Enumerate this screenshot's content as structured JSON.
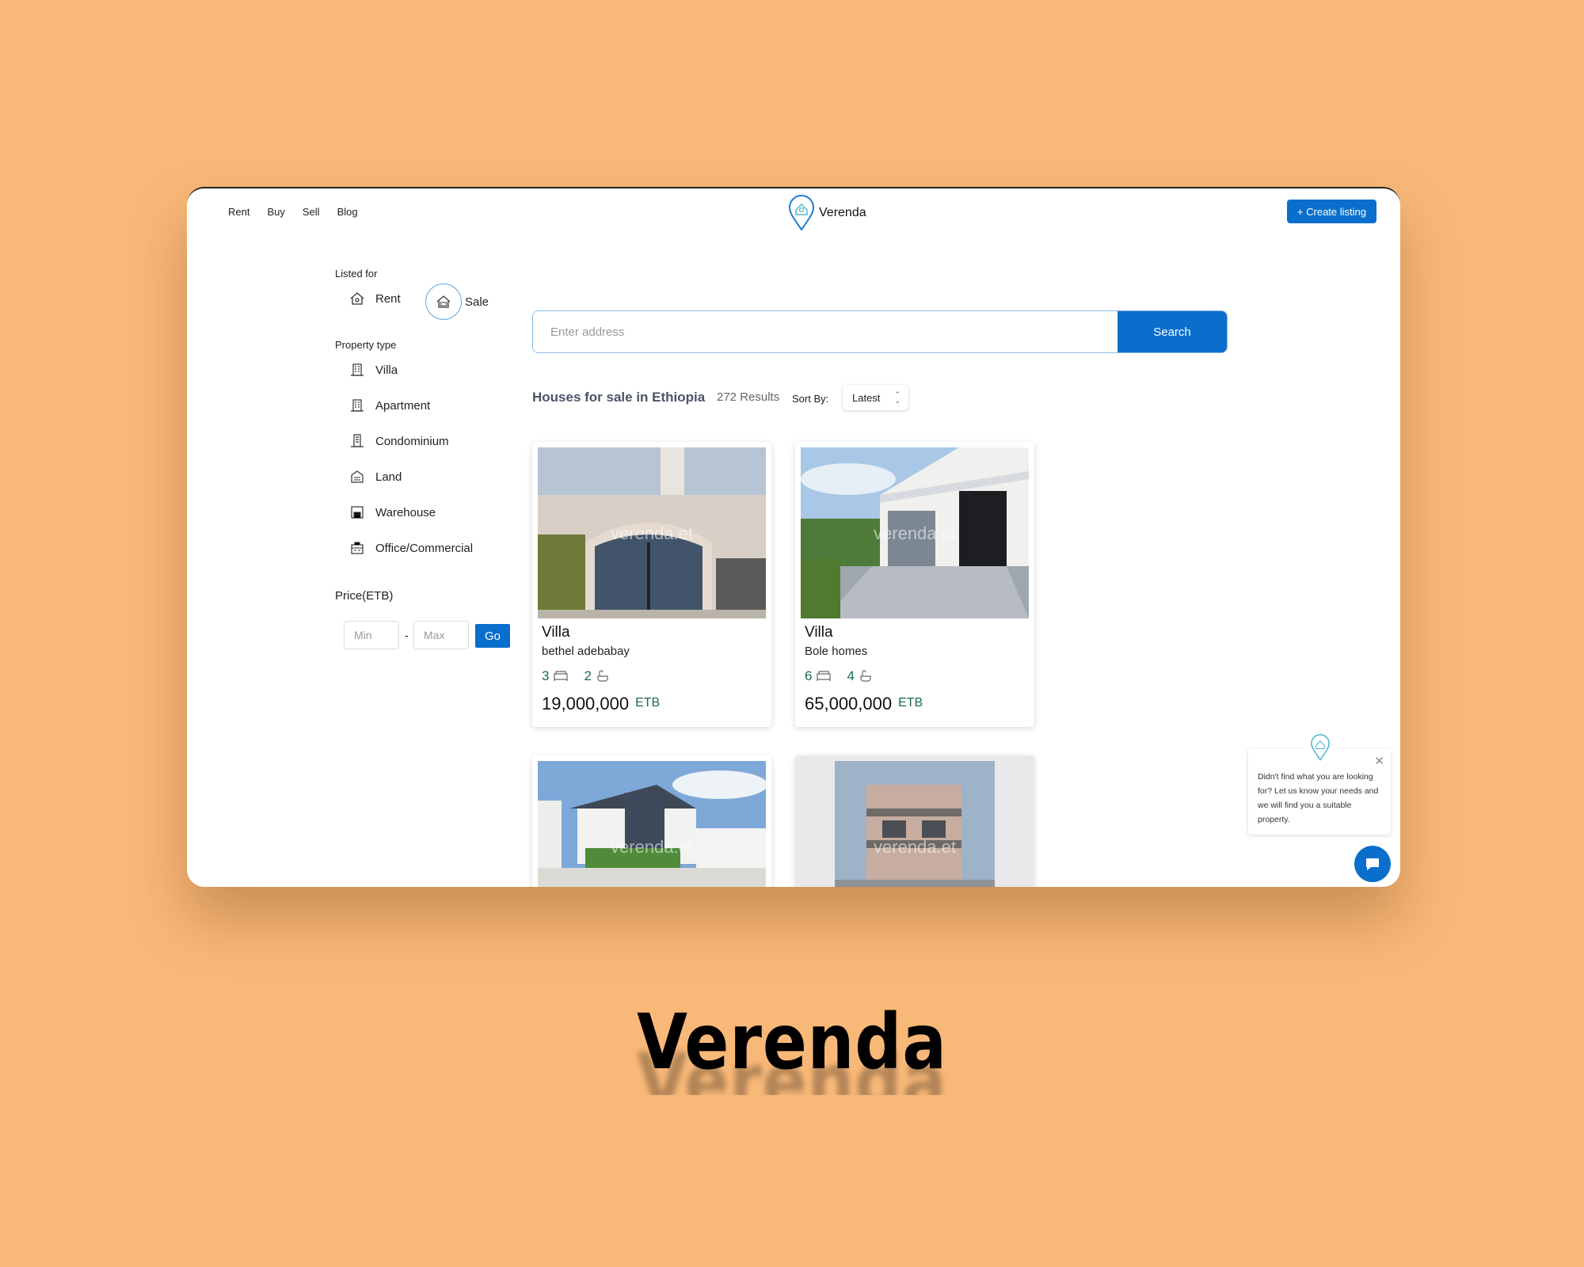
{
  "nav": {
    "links": [
      "Rent",
      "Buy",
      "Sell",
      "Blog"
    ],
    "brand": "Verenda",
    "create_listing": "+ Create listing"
  },
  "sidebar": {
    "listed_for_label": "Listed for",
    "listed_for": [
      {
        "label": "Rent",
        "icon": "house-key-icon"
      },
      {
        "label": "Sale",
        "icon": "house-sale-icon",
        "selected": true
      }
    ],
    "property_type_label": "Property type",
    "property_types": [
      {
        "label": "Villa",
        "icon": "villa-icon"
      },
      {
        "label": "Apartment",
        "icon": "apartment-icon"
      },
      {
        "label": "Condominium",
        "icon": "condominium-icon"
      },
      {
        "label": "Land",
        "icon": "land-icon"
      },
      {
        "label": "Warehouse",
        "icon": "warehouse-icon"
      },
      {
        "label": "Office/Commercial",
        "icon": "office-icon"
      }
    ],
    "price_label": "Price(ETB)",
    "min_placeholder": "Min",
    "max_placeholder": "Max",
    "separator": "-",
    "go_label": "Go"
  },
  "search": {
    "placeholder": "Enter address",
    "button": "Search"
  },
  "results": {
    "title": "Houses for sale in Ethiopia",
    "count": "272 Results",
    "sort_label": "Sort By:",
    "sort_value": "Latest"
  },
  "watermark": "verenda.et",
  "listings": [
    {
      "type": "Villa",
      "owner": "bethel adebabay",
      "beds": "3",
      "baths": "2",
      "price": "19,000,000",
      "currency": "ETB"
    },
    {
      "type": "Villa",
      "owner": "Bole homes",
      "beds": "6",
      "baths": "4",
      "price": "65,000,000",
      "currency": "ETB"
    },
    {},
    {}
  ],
  "popup": {
    "text": "Didn't find what you are looking for? Let us know your needs and we will find you a suitable property."
  },
  "hero_title": "Verenda",
  "colors": {
    "background": "#f8b878",
    "primary": "#0a6fcc",
    "feature_green": "#1a6a4a"
  }
}
